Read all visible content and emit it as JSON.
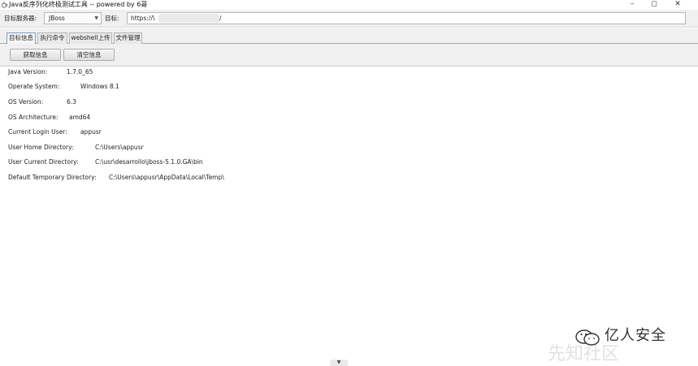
{
  "window": {
    "title": "Java反序列化终极测试工具 -- powered by 6哥",
    "minimize_glyph": "–",
    "restore_glyph": "◻",
    "close_glyph": "✕",
    "icon": "coffee-cup-icon"
  },
  "toolbar": {
    "server_label": "目标服务器:",
    "server_value": "JBoss",
    "target_label": "目标:",
    "url_prefix": "https://\\",
    "url_suffix": "/"
  },
  "tabs": [
    {
      "label": "目标信息",
      "active": true
    },
    {
      "label": "执行命令",
      "active": false
    },
    {
      "label": "webshell上传",
      "active": false
    },
    {
      "label": "文件管理",
      "active": false
    }
  ],
  "buttons": {
    "fetch_label": "获取信息",
    "clear_label": "清空信息"
  },
  "info": [
    {
      "key": "Java Version:",
      "value": "1.7.0_65"
    },
    {
      "key": "Operate System:",
      "value": "Windows 8.1"
    },
    {
      "key": "OS Version:",
      "value": "6.3"
    },
    {
      "key": "OS Architecture:",
      "value": "amd64"
    },
    {
      "key": "Current Login User:",
      "value": "appusr"
    },
    {
      "key": "User Home Directory:",
      "value": "C:\\Users\\appusr"
    },
    {
      "key": "User Current Directory:",
      "value": "C:\\usr\\desarrollo\\jboss-5.1.0.GA\\bin"
    },
    {
      "key": "Default Temporary Directory:",
      "value": "C:\\Users\\appusr\\AppData\\Local\\Temp\\"
    }
  ],
  "scroll_glyph": "▼",
  "watermark": {
    "text": "亿人安全",
    "ghost_text": "先知社区",
    "icon": "wechat-icon"
  }
}
